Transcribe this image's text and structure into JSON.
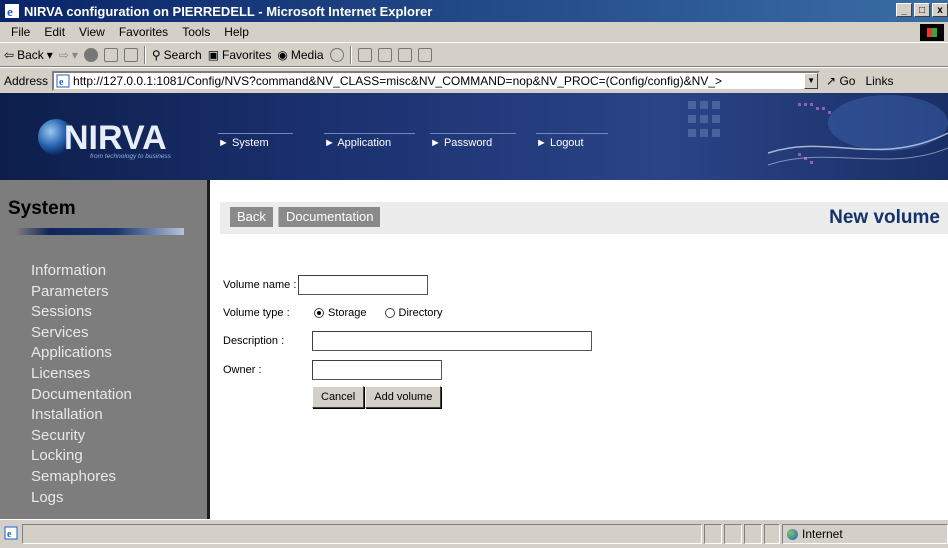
{
  "window": {
    "title": "NIRVA configuration on PIERREDELL - Microsoft Internet Explorer",
    "controls": [
      "_",
      "□",
      "x"
    ]
  },
  "menu": [
    "File",
    "Edit",
    "View",
    "Favorites",
    "Tools",
    "Help"
  ],
  "toolbar": {
    "back": "Back",
    "search": "Search",
    "favorites": "Favorites",
    "media": "Media"
  },
  "address": {
    "label": "Address",
    "url": "http://127.0.0.1:1081/Config/NVS?command&NV_CLASS=misc&NV_COMMAND=nop&NV_PROC=(Config/config)&NV_>",
    "go": "Go",
    "links": "Links"
  },
  "banner": {
    "logo_text": "NIRVA",
    "tagline": "from technology to business",
    "nav": [
      "System",
      "Application",
      "Password",
      "Logout"
    ]
  },
  "sidebar": {
    "title": "System",
    "items": [
      "Information",
      "Parameters",
      "Sessions",
      "Services",
      "Applications",
      "Licenses",
      "Documentation",
      "Installation",
      "Security",
      "Locking",
      "Semaphores",
      "Logs"
    ]
  },
  "header": {
    "back": "Back",
    "documentation": "Documentation",
    "page_title": "New volume"
  },
  "form": {
    "volume_name_label": "Volume name :",
    "volume_name_value": "",
    "volume_type_label": "Volume type :",
    "type_options": [
      "Storage",
      "Directory"
    ],
    "type_selected": "Storage",
    "description_label": "Description :",
    "description_value": "",
    "owner_label": "Owner :",
    "owner_value": "",
    "cancel": "Cancel",
    "add": "Add volume"
  },
  "status": {
    "zone": "Internet"
  },
  "colors": {
    "banner": "#1b3170",
    "sidebar": "#7d7d7d",
    "title_accent": "#14336b"
  }
}
